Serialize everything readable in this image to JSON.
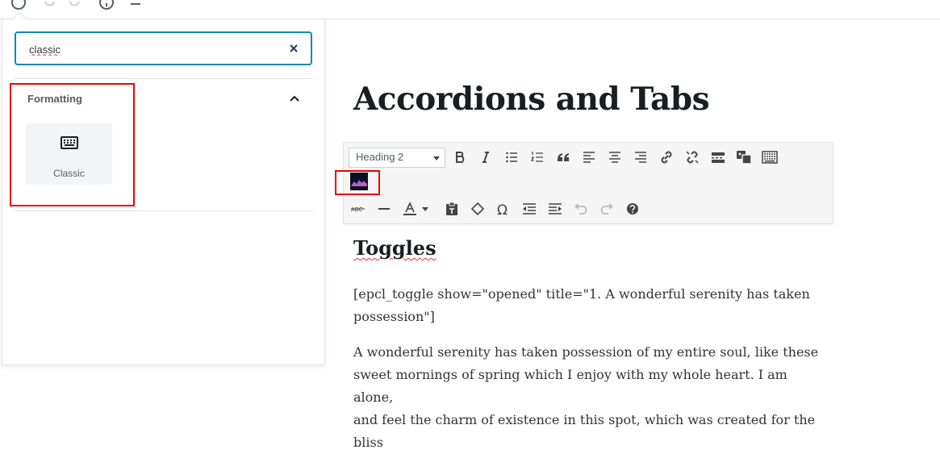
{
  "inserter": {
    "search_value": "classic",
    "section_title": "Formatting",
    "block_label": "Classic"
  },
  "post": {
    "title": "Accordions and Tabs"
  },
  "classic_toolbar": {
    "format_select": "Heading 2"
  },
  "content": {
    "heading": "Toggles",
    "p1_line1": "[epcl_toggle show=\"opened\" title=\"1. A wonderful serenity has taken",
    "p1_line2": "possession\"]",
    "p2_line1": "A wonderful serenity has taken possession of my entire soul, like these",
    "p2_line2": "sweet mornings of spring which I enjoy with my whole heart. I am alone,",
    "p2_line3": "and feel the charm of existence in this spot, which was created for the bliss"
  },
  "colors": {
    "search_border": "#0e8aa5",
    "highlight": "#e00000",
    "spell_underline": "#dd3333"
  }
}
